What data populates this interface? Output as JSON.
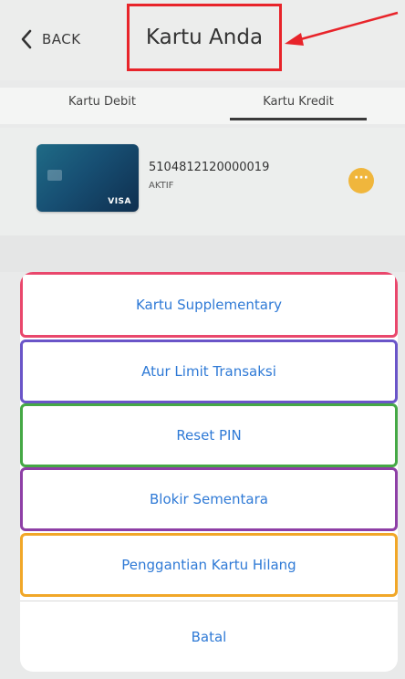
{
  "header": {
    "back_label": "BACK",
    "title": "Kartu Anda"
  },
  "tabs": [
    {
      "label": "Kartu Debit",
      "active": false
    },
    {
      "label": "Kartu Kredit",
      "active": true
    }
  ],
  "card": {
    "number": "5104812120000019",
    "status": "AKTIF",
    "brand": "VISA",
    "more_label": "···"
  },
  "action_sheet": {
    "items": [
      {
        "label": "Kartu Supplementary",
        "highlight_color": "#e9476c"
      },
      {
        "label": "Atur Limit Transaksi",
        "highlight_color": "#6a55c8"
      },
      {
        "label": "Reset PIN",
        "highlight_color": "#45a845"
      },
      {
        "label": "Blokir Sementara",
        "highlight_color": "#8e3fa6"
      },
      {
        "label": "Penggantian Kartu Hilang",
        "highlight_color": "#f1a728"
      }
    ],
    "cancel_label": "Batal"
  },
  "colors": {
    "accent_blue": "#2f7ad6",
    "annotation_red": "#e8242a",
    "more_button": "#f0b63c"
  }
}
